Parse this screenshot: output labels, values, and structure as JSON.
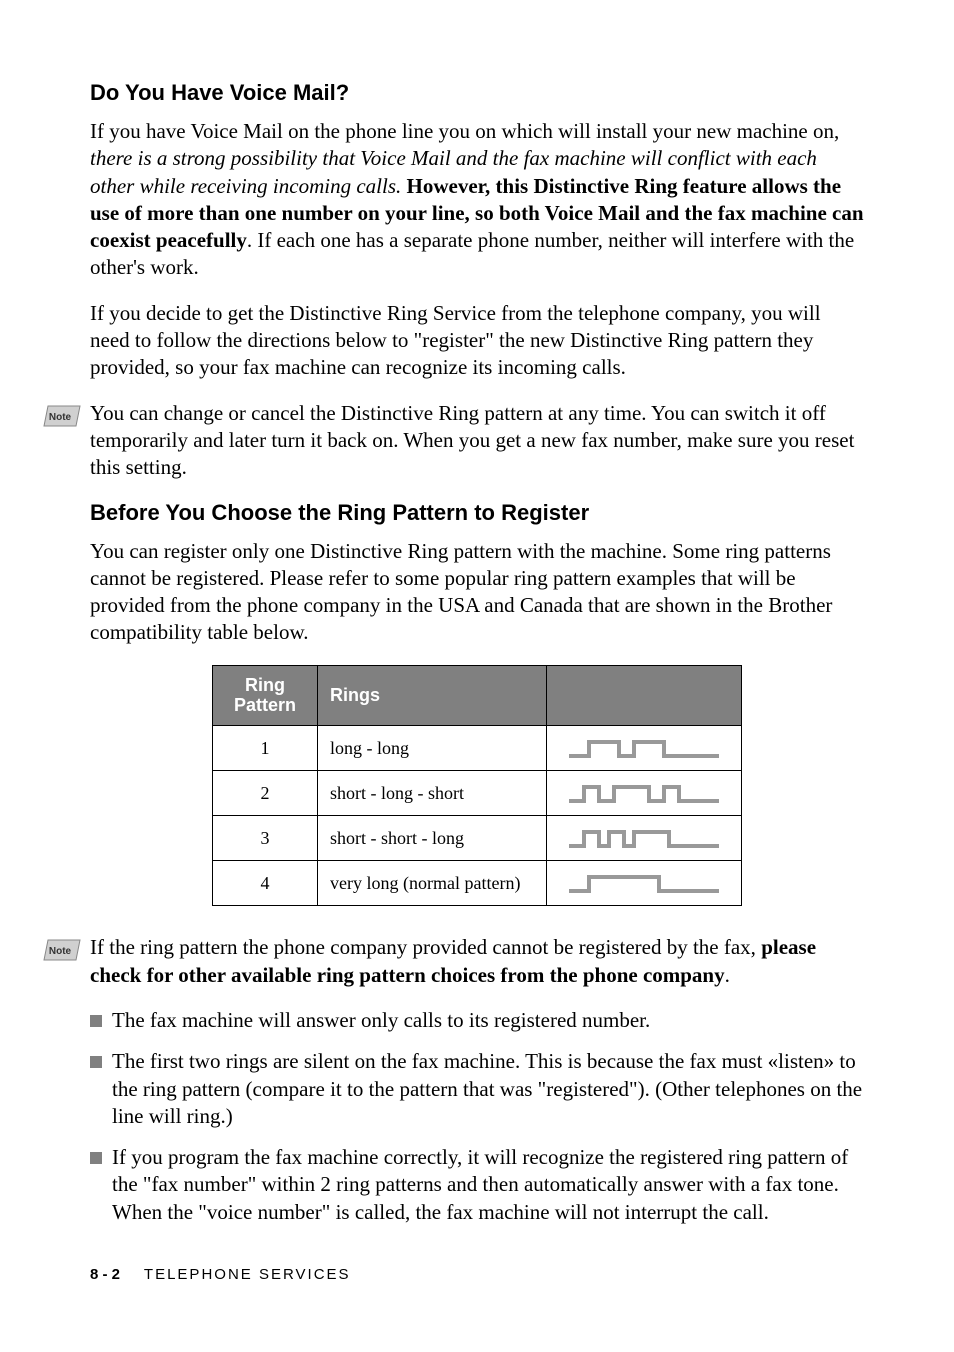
{
  "heading1": "Do You Have Voice Mail?",
  "p1_part1": "If you have Voice Mail on the phone line you on which will install your new machine on, ",
  "p1_italic": "there is a strong possibility that Voice Mail and the fax machine will conflict with each other while receiving incoming calls.",
  "p1_bold": " However, this Distinctive Ring feature allows the use of more than one number on your line, so both Voice Mail and the fax machine can coexist peacefully",
  "p1_part2": ". If each one has a separate phone number, neither will interfere with the other's work.",
  "p2": "If you decide to get the Distinctive Ring Service from the telephone company, you will need to follow the directions below to \"register\" the new Distinctive Ring pattern they provided, so your fax machine can recognize its incoming calls.",
  "note1": "You can change or cancel the Distinctive Ring pattern at any time. You can switch it off temporarily and later turn it back on. When you get a new fax number, make sure you reset this setting.",
  "heading2": "Before You Choose the Ring Pattern to Register",
  "p3": "You can register only one Distinctive Ring pattern with the machine. Some ring patterns cannot be registered. Please refer to some popular ring pattern examples that will be provided from the phone company in the USA and Canada that are shown in the Brother compatibility table below.",
  "table": {
    "head": {
      "pattern_line1": "Ring",
      "pattern_line2": "Pattern",
      "rings": "Rings"
    },
    "rows": [
      {
        "num": "1",
        "desc": "long - long"
      },
      {
        "num": "2",
        "desc": "short - long - short"
      },
      {
        "num": "3",
        "desc": "short - short - long"
      },
      {
        "num": "4",
        "desc": "very long (normal pattern)"
      }
    ]
  },
  "note2_part1": "If the ring pattern the phone company provided cannot be registered by the fax, ",
  "note2_bold": "please check for other available ring pattern choices from the phone company",
  "note2_part2": ".",
  "bullets": [
    "The fax machine will answer only calls to its registered number.",
    "The first two rings are silent on the fax machine. This is because the fax must «listen» to the ring pattern (compare it to the pattern that was \"registered\"). (Other telephones on the line will ring.)",
    "If you program the fax machine correctly, it will recognize the registered ring pattern of the \"fax number\" within 2 ring patterns and then automatically answer with a fax tone. When the \"voice number\" is called, the fax machine will not interrupt the call."
  ],
  "footer": {
    "page": "8 - 2",
    "section": "TELEPHONE SERVICES"
  }
}
